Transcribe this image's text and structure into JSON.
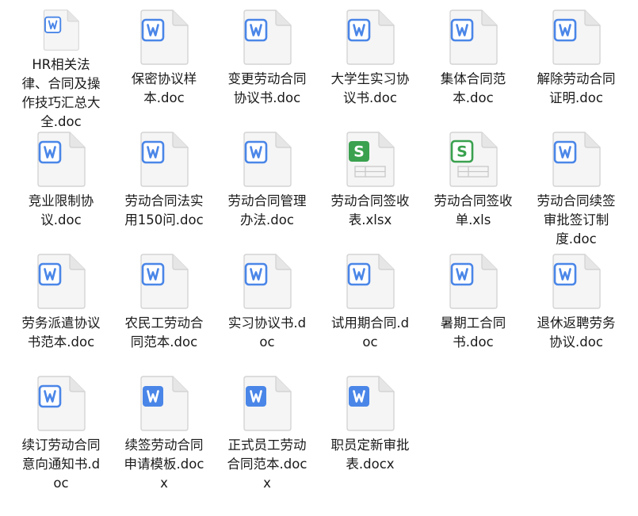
{
  "colors": {
    "word_blue": "#4a86e8",
    "excel_green": "#3aa14f",
    "page_fill": "#f5f5f5",
    "page_stroke": "#d4d4d4"
  },
  "files": [
    {
      "name": "HR相关法律、合同及操作技巧汇总大全.doc",
      "type": "doc",
      "icon": "word-doc-icon"
    },
    {
      "name": "保密协议样本.doc",
      "type": "doc",
      "icon": "word-doc-icon"
    },
    {
      "name": "变更劳动合同协议书.doc",
      "type": "doc",
      "icon": "word-doc-icon"
    },
    {
      "name": "大学生实习协议书.doc",
      "type": "doc",
      "icon": "word-doc-icon"
    },
    {
      "name": "集体合同范本.doc",
      "type": "doc",
      "icon": "word-doc-icon"
    },
    {
      "name": "解除劳动合同证明.doc",
      "type": "doc",
      "icon": "word-doc-icon"
    },
    {
      "name": "竞业限制协议.doc",
      "type": "doc",
      "icon": "word-doc-icon"
    },
    {
      "name": "劳动合同法实用150问.doc",
      "type": "doc",
      "icon": "word-doc-icon"
    },
    {
      "name": "劳动合同管理办法.doc",
      "type": "doc",
      "icon": "word-doc-icon"
    },
    {
      "name": "劳动合同签收表.xlsx",
      "type": "xlsx",
      "icon": "excel-xlsx-icon"
    },
    {
      "name": "劳动合同签收单.xls",
      "type": "xls",
      "icon": "excel-xls-icon"
    },
    {
      "name": "劳动合同续签审批签订制度.doc",
      "type": "doc",
      "icon": "word-doc-icon"
    },
    {
      "name": "劳务派遣协议书范本.doc",
      "type": "doc",
      "icon": "word-doc-icon"
    },
    {
      "name": "农民工劳动合同范本.doc",
      "type": "doc",
      "icon": "word-doc-icon"
    },
    {
      "name": "实习协议书.doc",
      "type": "doc",
      "icon": "word-doc-icon"
    },
    {
      "name": "试用期合同.doc",
      "type": "doc",
      "icon": "word-doc-icon"
    },
    {
      "name": "暑期工合同书.doc",
      "type": "doc",
      "icon": "word-doc-icon"
    },
    {
      "name": "退休返聘劳务协议.doc",
      "type": "doc",
      "icon": "word-doc-icon"
    },
    {
      "name": "续订劳动合同意向通知书.doc",
      "type": "doc",
      "icon": "word-doc-icon"
    },
    {
      "name": "续签劳动合同申请模板.docx",
      "type": "docx",
      "icon": "word-docx-icon"
    },
    {
      "name": "正式员工劳动合同范本.docx",
      "type": "docx",
      "icon": "word-docx-icon"
    },
    {
      "name": "职员定新审批表.docx",
      "type": "docx",
      "icon": "word-docx-icon"
    }
  ]
}
